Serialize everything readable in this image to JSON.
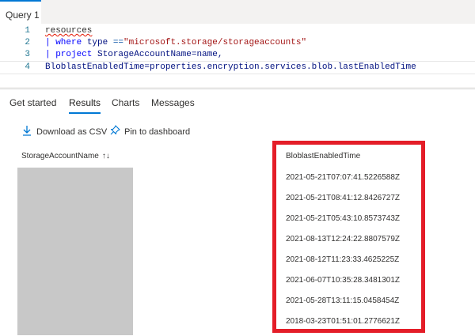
{
  "query_tab": {
    "label": "Query 1"
  },
  "editor": {
    "line_numbers": [
      "1",
      "2",
      "3",
      "4"
    ],
    "line1": {
      "text": "resources"
    },
    "line2": {
      "pipe": "| ",
      "kw": "where",
      "ident": " type ",
      "op": "==",
      "str": "\"microsoft.storage/storageaccounts\""
    },
    "line3": {
      "pipe": "| ",
      "kw": "project",
      "text": " StorageAccountName=name,"
    },
    "line4": {
      "text": "BloblastEnabledTime=properties.encryption.services.blob.lastEnabledTime"
    }
  },
  "results_tabs": [
    {
      "label": "Get started",
      "active": false
    },
    {
      "label": "Results",
      "active": true
    },
    {
      "label": "Charts",
      "active": false
    },
    {
      "label": "Messages",
      "active": false
    }
  ],
  "toolbar": {
    "download_label": "Download as CSV",
    "download_icon": "download-icon",
    "pin_label": "Pin to dashboard",
    "pin_icon": "pin-icon"
  },
  "table": {
    "columns": [
      "StorageAccountName",
      "BloblastEnabledTime"
    ],
    "sort_icon": "↑↓",
    "rows": [
      "2021-05-21T07:07:41.5226588Z",
      "2021-05-21T08:41:12.8426727Z",
      "2021-05-21T05:43:10.8573743Z",
      "2021-08-13T12:24:22.8807579Z",
      "2021-08-12T11:23:33.4625225Z",
      "2021-06-07T10:35:28.3481301Z",
      "2021-05-28T13:11:15.0458454Z",
      "2018-03-23T01:51:01.2776621Z"
    ]
  },
  "colors": {
    "accent": "#0078d4",
    "highlight_border": "#e41d28",
    "redaction": "#c8c8c8"
  }
}
